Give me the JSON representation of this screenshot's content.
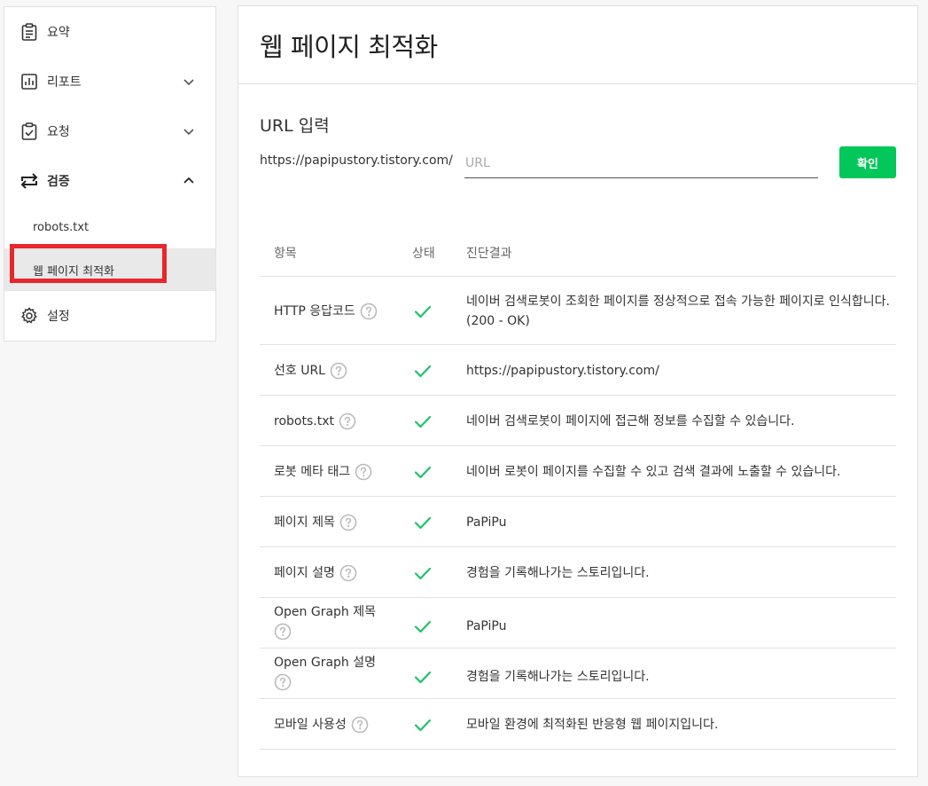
{
  "sidebar": {
    "items": [
      {
        "label": "요약",
        "icon": "clipboard-list-icon"
      },
      {
        "label": "리포트",
        "icon": "bar-chart-icon",
        "expanded": false
      },
      {
        "label": "요청",
        "icon": "clipboard-check-icon",
        "expanded": false
      },
      {
        "label": "검증",
        "icon": "swap-arrows-icon",
        "expanded": true
      },
      {
        "label": "설정",
        "icon": "gear-icon"
      }
    ],
    "sub_items": [
      {
        "label": "robots.txt"
      },
      {
        "label": "웹 페이지 최적화",
        "active": true
      }
    ]
  },
  "main": {
    "title": "웹 페이지 최적화",
    "url_section_label": "URL 입력",
    "url_prefix": "https://papipustory.tistory.com/",
    "url_placeholder": "URL",
    "url_value": "",
    "confirm_label": "확인",
    "table": {
      "headers": [
        "항목",
        "상태",
        "진단결과"
      ],
      "rows": [
        {
          "name": "HTTP 응답코드",
          "status": "ok",
          "result": "네이버 검색로봇이 조회한 페이지를 정상적으로 접속 가능한 페이지로 인식합니다.(200 - OK)"
        },
        {
          "name": "선호 URL",
          "status": "ok",
          "result": "https://papipustory.tistory.com/"
        },
        {
          "name": "robots.txt",
          "status": "ok",
          "result": "네이버 검색로봇이 페이지에 접근해 정보를 수집할 수 있습니다."
        },
        {
          "name": "로봇 메타 태그",
          "status": "ok",
          "result": "네이버 로봇이 페이지를 수집할 수 있고 검색 결과에 노출할 수 있습니다."
        },
        {
          "name": "페이지 제목",
          "status": "ok",
          "result": "PaPiPu"
        },
        {
          "name": "페이지 설명",
          "status": "ok",
          "result": "경험을 기록해나가는 스토리입니다."
        },
        {
          "name": "Open Graph 제목",
          "status": "ok",
          "result": "PaPiPu"
        },
        {
          "name": "Open Graph 설명",
          "status": "ok",
          "result": "경험을 기록해나가는 스토리입니다."
        },
        {
          "name": "모바일 사용성",
          "status": "ok",
          "result": "모바일 환경에 최적화된 반응형 웹 페이지입니다."
        }
      ]
    }
  },
  "colors": {
    "accent_green": "#03c75a",
    "highlight_red": "#e8262d",
    "check_green": "#1ec26a"
  }
}
